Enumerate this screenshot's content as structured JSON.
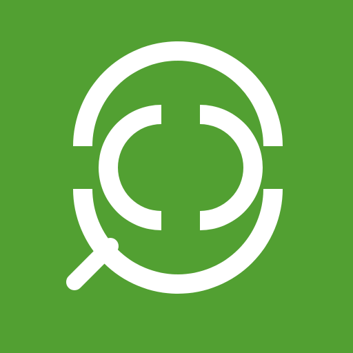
{
  "icon": {
    "name": "magnifier-search-app-icon",
    "colors": {
      "background": "#52A032",
      "foreground": "#FFFFFF"
    }
  }
}
